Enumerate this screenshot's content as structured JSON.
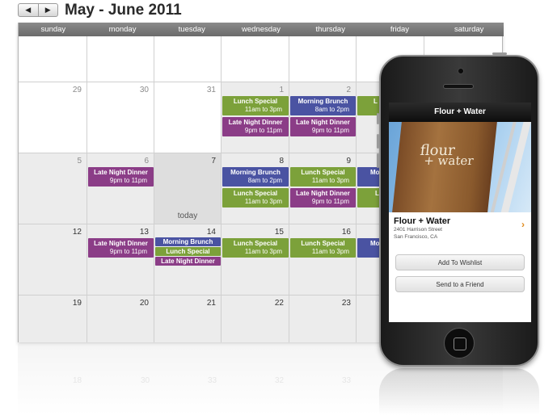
{
  "header": {
    "prev_icon": "◀",
    "next_icon": "▶",
    "title": "May - June 2011"
  },
  "calendar": {
    "weekdays": [
      "sunday",
      "monday",
      "tuesday",
      "wednesday",
      "thursday",
      "friday",
      "saturday"
    ],
    "today_label": "today",
    "day_numbers": {
      "r1": [
        "29",
        "30",
        "31",
        "1",
        "2"
      ],
      "r2": [
        "5",
        "6",
        "7",
        "8",
        "9"
      ],
      "r3": [
        "12",
        "13",
        "14",
        "15",
        "16"
      ],
      "r4": [
        "19",
        "20",
        "21",
        "22",
        "23"
      ]
    },
    "events": {
      "lunch_special": "Lunch Special",
      "lunch_time": "11am to 3pm",
      "brunch": "Morning Brunch",
      "brunch_time": "8am to 2pm",
      "dinner": "Late Night Dinner",
      "dinner_time": "9pm to 11pm",
      "cut_label": "L",
      "cut_label2": "Mo"
    },
    "reflection_numbers": [
      "18",
      "30",
      "33",
      "32",
      "33"
    ]
  },
  "phone": {
    "screen_title": "Flour + Water",
    "photo_sign_line1": "flour",
    "photo_sign_line2": "+ water",
    "venue_name": "Flour + Water",
    "venue_street": "2401 Harrison Street",
    "venue_city": "San Francisco, CA",
    "chevron": "›",
    "button_wishlist": "Add To Wishlist",
    "button_send": "Send to a Friend"
  },
  "colors": {
    "green": "#7ca13a",
    "blue": "#4a53a2",
    "purple": "#8b3d87",
    "accent_orange": "#e08b1e"
  }
}
